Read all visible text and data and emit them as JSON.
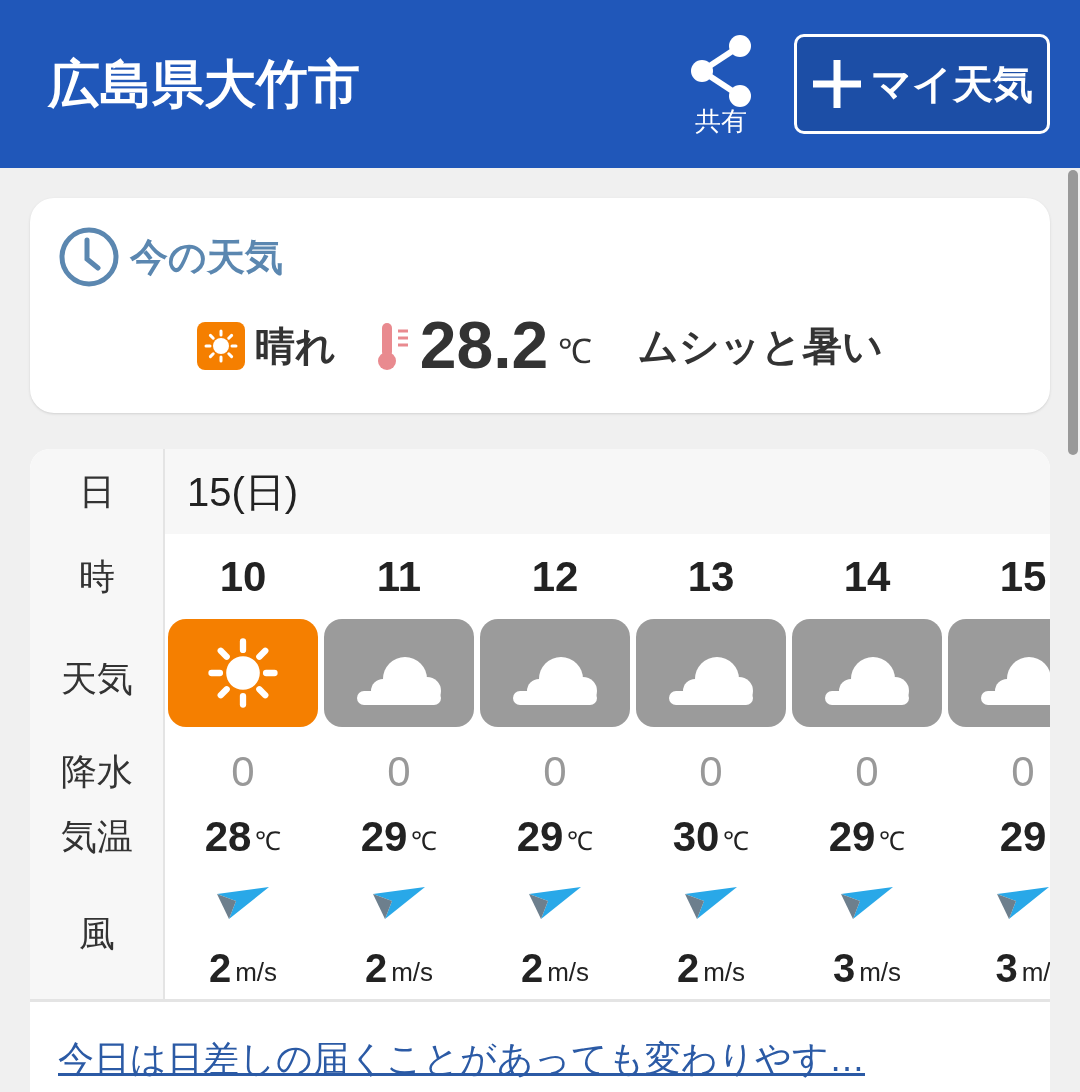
{
  "header": {
    "title": "広島県大竹市",
    "share_label": "共有",
    "my_weather_button": "マイ天気"
  },
  "current": {
    "heading": "今の天気",
    "condition": "晴れ",
    "temperature": "28.2",
    "temperature_unit": "℃",
    "feeling": "ムシッと暑い"
  },
  "forecast": {
    "row_labels": {
      "date": "日",
      "hour": "時",
      "weather": "天気",
      "precip": "降水",
      "temp": "気温",
      "wind": "風"
    },
    "date": "15(日)",
    "hours": [
      {
        "hour": "10",
        "kind": "sunny",
        "precip": "0",
        "temp": "28",
        "temp_unit": "℃",
        "wind": "2",
        "wind_unit": "m/s"
      },
      {
        "hour": "11",
        "kind": "cloudy",
        "precip": "0",
        "temp": "29",
        "temp_unit": "℃",
        "wind": "2",
        "wind_unit": "m/s"
      },
      {
        "hour": "12",
        "kind": "cloudy",
        "precip": "0",
        "temp": "29",
        "temp_unit": "℃",
        "wind": "2",
        "wind_unit": "m/s"
      },
      {
        "hour": "13",
        "kind": "cloudy",
        "precip": "0",
        "temp": "30",
        "temp_unit": "℃",
        "wind": "2",
        "wind_unit": "m/s"
      },
      {
        "hour": "14",
        "kind": "cloudy",
        "precip": "0",
        "temp": "29",
        "temp_unit": "℃",
        "wind": "3",
        "wind_unit": "m/s"
      },
      {
        "hour": "15",
        "kind": "cloudy",
        "precip": "0",
        "temp": "29",
        "wind": "3",
        "wind_unit": "m/"
      }
    ]
  },
  "summary_link": "今日は日差しの届くことがあっても変わりやす…"
}
